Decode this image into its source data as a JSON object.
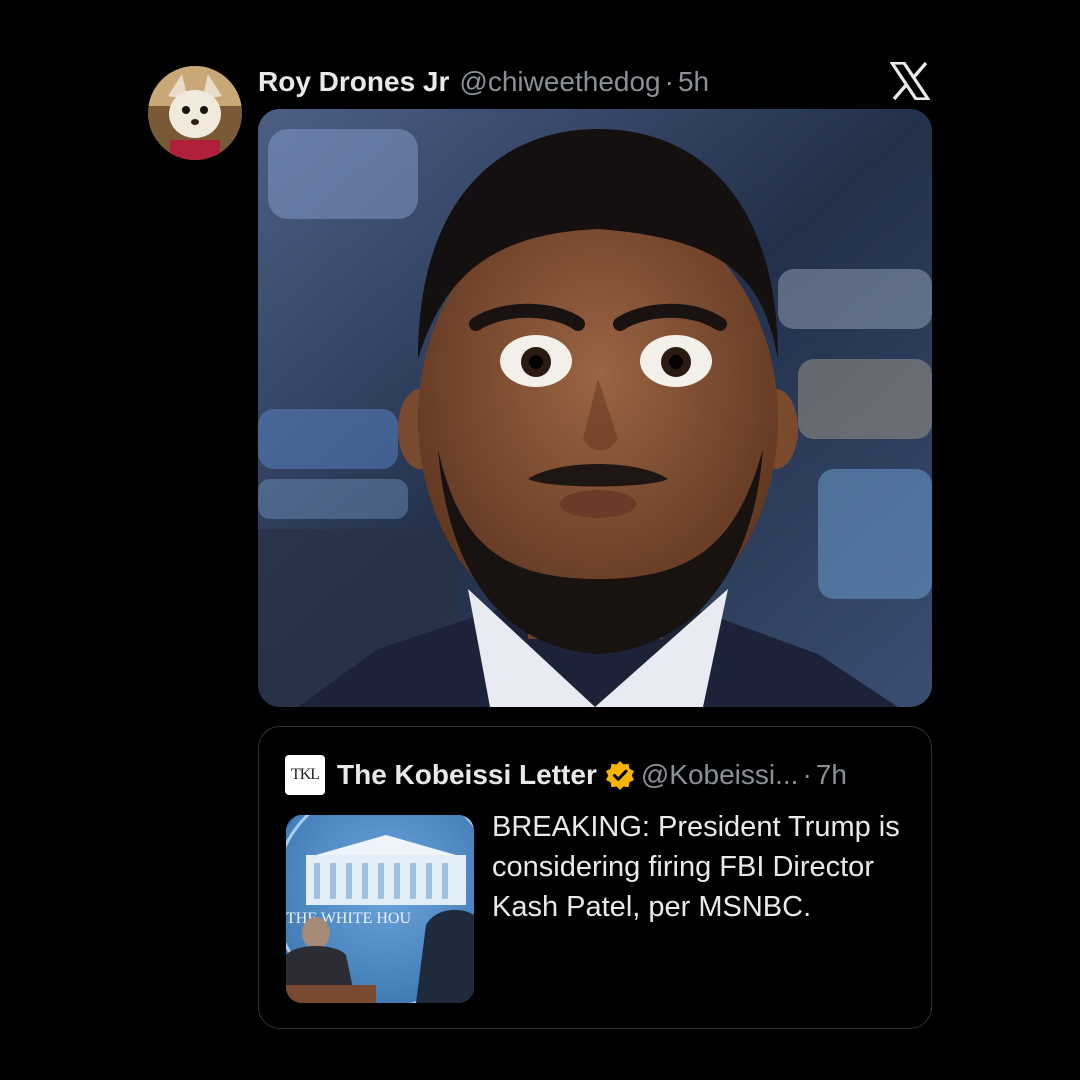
{
  "tweet": {
    "author_name": "Roy Drones Jr",
    "author_handle": "@chiweethedog",
    "separator": "·",
    "time": "5h",
    "avatar_icon": "chihuahua-avatar",
    "platform_icon": "x-logo-icon"
  },
  "quote": {
    "logo_text": "TKL",
    "author_name": "The Kobeissi Letter",
    "verified": true,
    "verified_color": "#f4b400",
    "author_handle": "@Kobeissi...",
    "separator": "·",
    "time": "7h",
    "text": "BREAKING: President Trump is considering firing FBI Director Kash Patel, per MSNBC.",
    "thumb_caption": "THE WHITE HOU"
  },
  "colors": {
    "background": "#000000",
    "text_primary": "#e7e9ea",
    "text_secondary": "#8b9096",
    "border": "#2f3336"
  }
}
